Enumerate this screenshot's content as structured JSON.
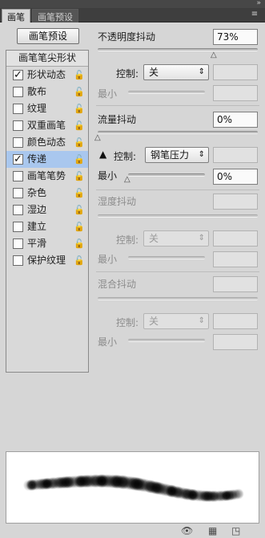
{
  "tabs": [
    {
      "label": "画笔",
      "active": true
    },
    {
      "label": "画笔预设",
      "active": false
    }
  ],
  "preset_button": "画笔预设",
  "left_list": {
    "header": "画笔笔尖形状",
    "items": [
      {
        "label": "形状动态",
        "checked": true,
        "selected": false
      },
      {
        "label": "散布",
        "checked": false,
        "selected": false
      },
      {
        "label": "纹理",
        "checked": false,
        "selected": false
      },
      {
        "label": "双重画笔",
        "checked": false,
        "selected": false
      },
      {
        "label": "颜色动态",
        "checked": false,
        "selected": false
      },
      {
        "label": "传递",
        "checked": true,
        "selected": true
      },
      {
        "label": "画笔笔势",
        "checked": false,
        "selected": false
      },
      {
        "label": "杂色",
        "checked": false,
        "selected": false
      },
      {
        "label": "湿边",
        "checked": false,
        "selected": false
      },
      {
        "label": "建立",
        "checked": false,
        "selected": false
      },
      {
        "label": "平滑",
        "checked": false,
        "selected": false
      },
      {
        "label": "保护纹理",
        "checked": false,
        "selected": false
      }
    ],
    "check_glyph": "✓",
    "lock_icon": "lock-icon"
  },
  "opacity_jitter": {
    "title": "不透明度抖动",
    "value": "73%",
    "slider_fraction": 0.73,
    "control_label": "控制:",
    "control_value": "关",
    "min_label": "最小"
  },
  "flow_jitter": {
    "title": "流量抖动",
    "value": "0%",
    "control_label": "控制:",
    "control_value": "钢笔压力",
    "min_label": "最小",
    "min_value": "0%",
    "warning_glyph": "▲"
  },
  "wetness_jitter": {
    "title": "湿度抖动",
    "control_label": "控制:",
    "control_value": "关",
    "min_label": "最小"
  },
  "mix_jitter": {
    "title": "混合抖动",
    "control_label": "控制:",
    "control_value": "关",
    "min_label": "最小"
  },
  "colors": {
    "selected_row": "#a9c7ee",
    "panel_bg": "#d6d6d6",
    "tabbar_bg": "#3e3e3e"
  },
  "bottom_icons": [
    "eye-icon",
    "grid-icon",
    "new-preset-icon"
  ]
}
